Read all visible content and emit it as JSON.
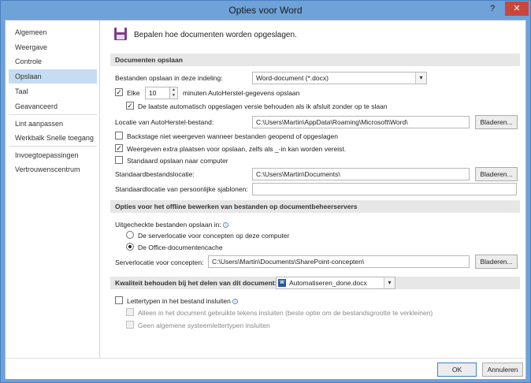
{
  "window": {
    "title": "Opties voor Word",
    "help": "?",
    "close": "✕"
  },
  "sidebar": {
    "items": [
      {
        "label": "Algemeen"
      },
      {
        "label": "Weergave"
      },
      {
        "label": "Controle"
      },
      {
        "label": "Opslaan"
      },
      {
        "label": "Taal"
      },
      {
        "label": "Geavanceerd"
      },
      {
        "label": "Lint aanpassen"
      },
      {
        "label": "Werkbalk Snelle toegang"
      },
      {
        "label": "Invoegtoepassingen"
      },
      {
        "label": "Vertrouwenscentrum"
      }
    ],
    "active": "Opslaan"
  },
  "header": {
    "text": "Bepalen hoe documenten worden opgeslagen.",
    "icon": "save-icon"
  },
  "save_docs": {
    "section": "Documenten opslaan",
    "format_label": "Bestanden opslaan in deze indeling:",
    "format_value": "Word-document (*.docx)",
    "autosave_every_label": "Elke",
    "autosave_minutes": "10",
    "autosave_suffix": "minuten AutoHerstel-gegevens opslaan",
    "autosave_checked": true,
    "keep_last_label": "De laatste automatisch opgeslagen versie behouden als ik afsluit zonder op te slaan",
    "keep_last_checked": true,
    "autorecover_loc_label": "Locatie van AutoHerstel-bestand:",
    "autorecover_loc_value": "C:\\Users\\Martin\\AppData\\Roaming\\Microsoft\\Word\\",
    "browse1": "Bladeren...",
    "backstage_label": "Backstage niet weergeven wanneer bestanden geopend of opgeslagen",
    "backstage_checked": false,
    "extra_places_label": "Weergeven extra plaatsen voor opslaan, zelfs als _-in kan worden vereist.",
    "extra_places_checked": true,
    "default_local_label": "Standaard opslaan naar computer",
    "default_local_checked": false,
    "default_loc_label": "Standaardbestandslocatie:",
    "default_loc_value": "C:\\Users\\Martin\\Documents\\",
    "browse2": "Bladeren...",
    "templates_loc_label": "Standaardlocatie van persoonlijke sjablonen:",
    "templates_loc_value": ""
  },
  "offline": {
    "section": "Opties voor het offline bewerken van bestanden op documentbeheerservers",
    "checkout_label": "Uitgecheckte bestanden opslaan in:",
    "radio1": "De serverlocatie voor concepten op deze computer",
    "radio2": "De Office-documentencache",
    "selected": "radio2",
    "server_loc_label": "Serverlocatie voor concepten:",
    "server_loc_value": "C:\\Users\\Martin\\Documents\\SharePoint-concepten\\",
    "browse3": "Bladeren..."
  },
  "quality": {
    "section": "Kwaliteit behouden bij het delen van dit document:",
    "doc_value": "Automatiseren_done.docx",
    "embed_label": "Lettertypen in het bestand insluiten",
    "embed_checked": false,
    "only_used_label": "Alleen in het document gebruikte tekens insluiten (beste optie om de bestandsgrootte te verkleinen)",
    "no_common_label": "Geen algemene systeemlettertypen insluiten"
  },
  "footer": {
    "ok": "OK",
    "cancel": "Annuleren"
  },
  "colors": {
    "titlebar": "#6fa2d8",
    "active_nav": "#c5dcf2",
    "close": "#c9463d"
  }
}
